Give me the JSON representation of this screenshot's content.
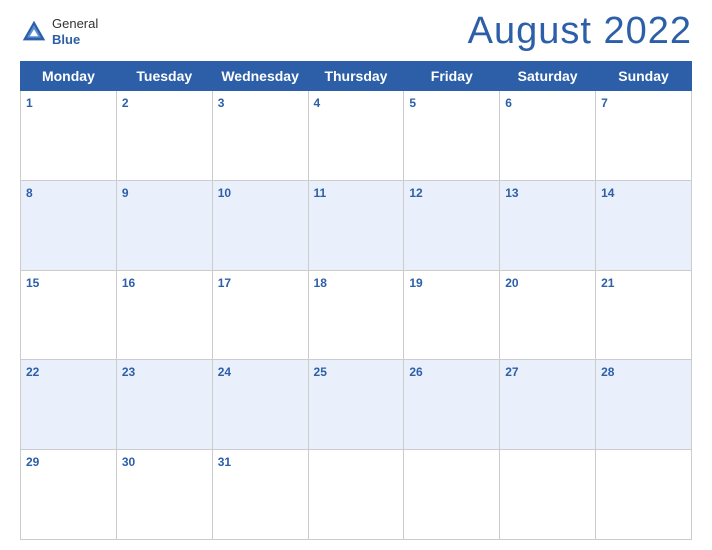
{
  "logo": {
    "line1": "General",
    "line2": "Blue"
  },
  "title": "August 2022",
  "days_of_week": [
    "Monday",
    "Tuesday",
    "Wednesday",
    "Thursday",
    "Friday",
    "Saturday",
    "Sunday"
  ],
  "weeks": [
    {
      "days": [
        {
          "num": "1",
          "empty": false
        },
        {
          "num": "2",
          "empty": false
        },
        {
          "num": "3",
          "empty": false
        },
        {
          "num": "4",
          "empty": false
        },
        {
          "num": "5",
          "empty": false
        },
        {
          "num": "6",
          "empty": false
        },
        {
          "num": "7",
          "empty": false
        }
      ]
    },
    {
      "days": [
        {
          "num": "8",
          "empty": false
        },
        {
          "num": "9",
          "empty": false
        },
        {
          "num": "10",
          "empty": false
        },
        {
          "num": "11",
          "empty": false
        },
        {
          "num": "12",
          "empty": false
        },
        {
          "num": "13",
          "empty": false
        },
        {
          "num": "14",
          "empty": false
        }
      ]
    },
    {
      "days": [
        {
          "num": "15",
          "empty": false
        },
        {
          "num": "16",
          "empty": false
        },
        {
          "num": "17",
          "empty": false
        },
        {
          "num": "18",
          "empty": false
        },
        {
          "num": "19",
          "empty": false
        },
        {
          "num": "20",
          "empty": false
        },
        {
          "num": "21",
          "empty": false
        }
      ]
    },
    {
      "days": [
        {
          "num": "22",
          "empty": false
        },
        {
          "num": "23",
          "empty": false
        },
        {
          "num": "24",
          "empty": false
        },
        {
          "num": "25",
          "empty": false
        },
        {
          "num": "26",
          "empty": false
        },
        {
          "num": "27",
          "empty": false
        },
        {
          "num": "28",
          "empty": false
        }
      ]
    },
    {
      "days": [
        {
          "num": "29",
          "empty": false
        },
        {
          "num": "30",
          "empty": false
        },
        {
          "num": "31",
          "empty": false
        },
        {
          "num": "",
          "empty": true
        },
        {
          "num": "",
          "empty": true
        },
        {
          "num": "",
          "empty": true
        },
        {
          "num": "",
          "empty": true
        }
      ]
    }
  ],
  "colors": {
    "header_bg": "#2c5fa8",
    "header_text": "#ffffff",
    "day_num_color": "#2c5fa8",
    "row_shade": "#eaf0fb"
  }
}
